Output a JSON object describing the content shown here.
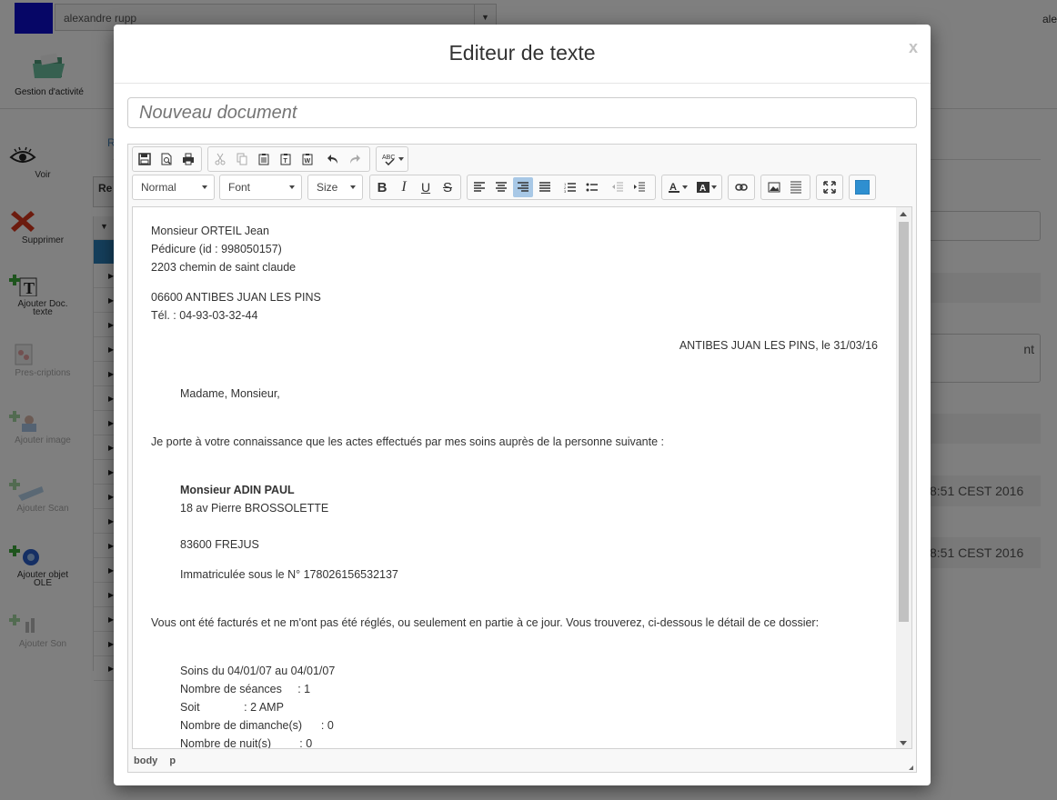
{
  "app": {
    "user_select": "alexandre rupp",
    "user_right": "ale",
    "gestion_label": "Gestion d'activité",
    "r_link": "R",
    "re_tab": "Re",
    "right_panel": {
      "textarea_text": "nt",
      "date1": "8:51 CEST 2016",
      "date2": "8:51 CEST 2016",
      "colon": ":"
    },
    "sidebar": [
      {
        "label": "Voir",
        "icon": "eye-icon"
      },
      {
        "label": "Supprimer",
        "icon": "delete-x-icon"
      },
      {
        "label": "Ajouter Doc. texte",
        "icon": "add-text-doc-icon"
      },
      {
        "label": "Pres-criptions",
        "icon": "prescription-icon"
      },
      {
        "label": "Ajouter image",
        "icon": "add-image-icon"
      },
      {
        "label": "Ajouter Scan",
        "icon": "add-scan-icon"
      },
      {
        "label": "Ajouter objet OLE",
        "icon": "add-ole-object-icon"
      },
      {
        "label": "Ajouter Son",
        "icon": "add-sound-icon"
      }
    ]
  },
  "modal": {
    "title": "Editeur de texte",
    "close": "x",
    "doc_title_placeholder": "Nouveau document",
    "toolbar": {
      "format": "Normal",
      "font": "Font",
      "size": "Size",
      "bold": "B",
      "italic": "I",
      "underline": "U",
      "strike": "S",
      "accent_color": "#2e8fd0"
    },
    "letter": {
      "sender_name": "Monsieur ORTEIL Jean",
      "sender_role": "Pédicure (id : 998050157)",
      "sender_address": "2203 chemin de saint claude",
      "sender_city": "06600 ANTIBES JUAN LES PINS",
      "sender_phone": "Tél. : 04-93-03-32-44",
      "place_date": "ANTIBES JUAN LES PINS, le 31/03/16",
      "salutation": "Madame, Monsieur,",
      "intro": "Je porte à votre connaissance que les actes effectués par mes soins auprès de la personne suivante :",
      "patient_name": "Monsieur ADIN PAUL",
      "patient_address": "18 av Pierre BROSSOLETTE",
      "patient_city": "83600 FREJUS",
      "patient_immat": "Immatriculée sous le N° 178026156532137",
      "billing": "Vous ont été facturés et ne m'ont pas été réglés, ou seulement en partie à ce jour. Vous trouverez, ci-dessous le détail de ce dossier:",
      "soins": "Soins du 04/01/07 au 04/01/07",
      "seances": "Nombre de séances     : 1",
      "soit": "Soit              : 2 AMP",
      "dimanches": "Nombre de dimanche(s)      : 0",
      "nuits": "Nombre de nuit(s)         : 0"
    },
    "status": {
      "path1": "body",
      "path2": "p"
    }
  }
}
